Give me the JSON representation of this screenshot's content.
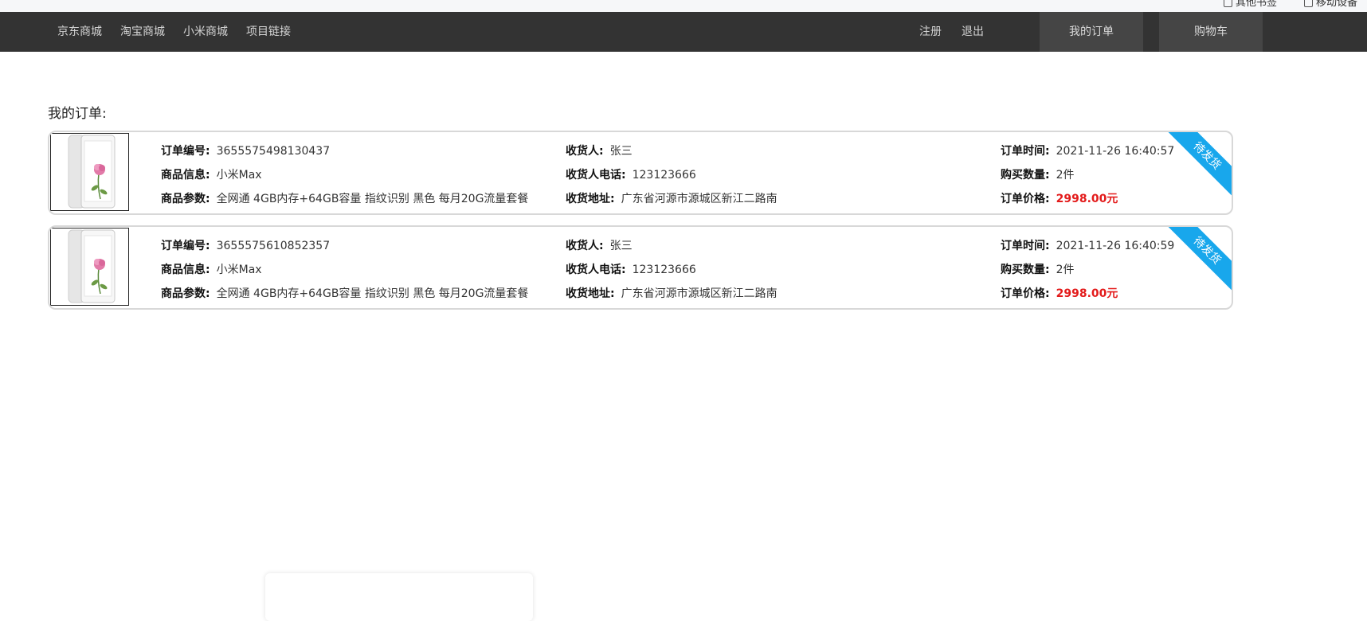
{
  "browser_strip": {
    "item1": "其他书签",
    "item2": "移动设备"
  },
  "nav": {
    "left_links": [
      "京东商城",
      "淘宝商城",
      "小米商城",
      "项目链接"
    ],
    "register": "注册",
    "logout": "退出",
    "my_orders": "我的订单",
    "cart": "购物车"
  },
  "page": {
    "title": "我的订单:"
  },
  "labels": {
    "order_no": "订单编号:",
    "product_info": "商品信息:",
    "product_params": "商品参数:",
    "receiver": "收货人:",
    "receiver_phone": "收货人电话:",
    "address": "收货地址:",
    "order_time": "订单时间:",
    "quantity": "购买数量:",
    "price": "订单价格:"
  },
  "orders": [
    {
      "order_no": "3655575498130437",
      "product_info": "小米Max",
      "product_params": "全网通 4GB内存+64GB容量 指纹识别 黑色 每月20G流量套餐",
      "receiver": "张三",
      "receiver_phone": "123123666",
      "address": "广东省河源市源城区新江二路南",
      "order_time": "2021-11-26 16:40:57",
      "quantity": "2件",
      "price": "2998.00元",
      "status": "待发货"
    },
    {
      "order_no": "3655575610852357",
      "product_info": "小米Max",
      "product_params": "全网通 4GB内存+64GB容量 指纹识别 黑色 每月20G流量套餐",
      "receiver": "张三",
      "receiver_phone": "123123666",
      "address": "广东省河源市源城区新江二路南",
      "order_time": "2021-11-26 16:40:59",
      "quantity": "2件",
      "price": "2998.00元",
      "status": "待发货"
    }
  ],
  "colors": {
    "navbar_bg": "#333333",
    "nav_tab_bg": "#454545",
    "ribbon": "#18a7ec",
    "price": "#e31b1b"
  }
}
